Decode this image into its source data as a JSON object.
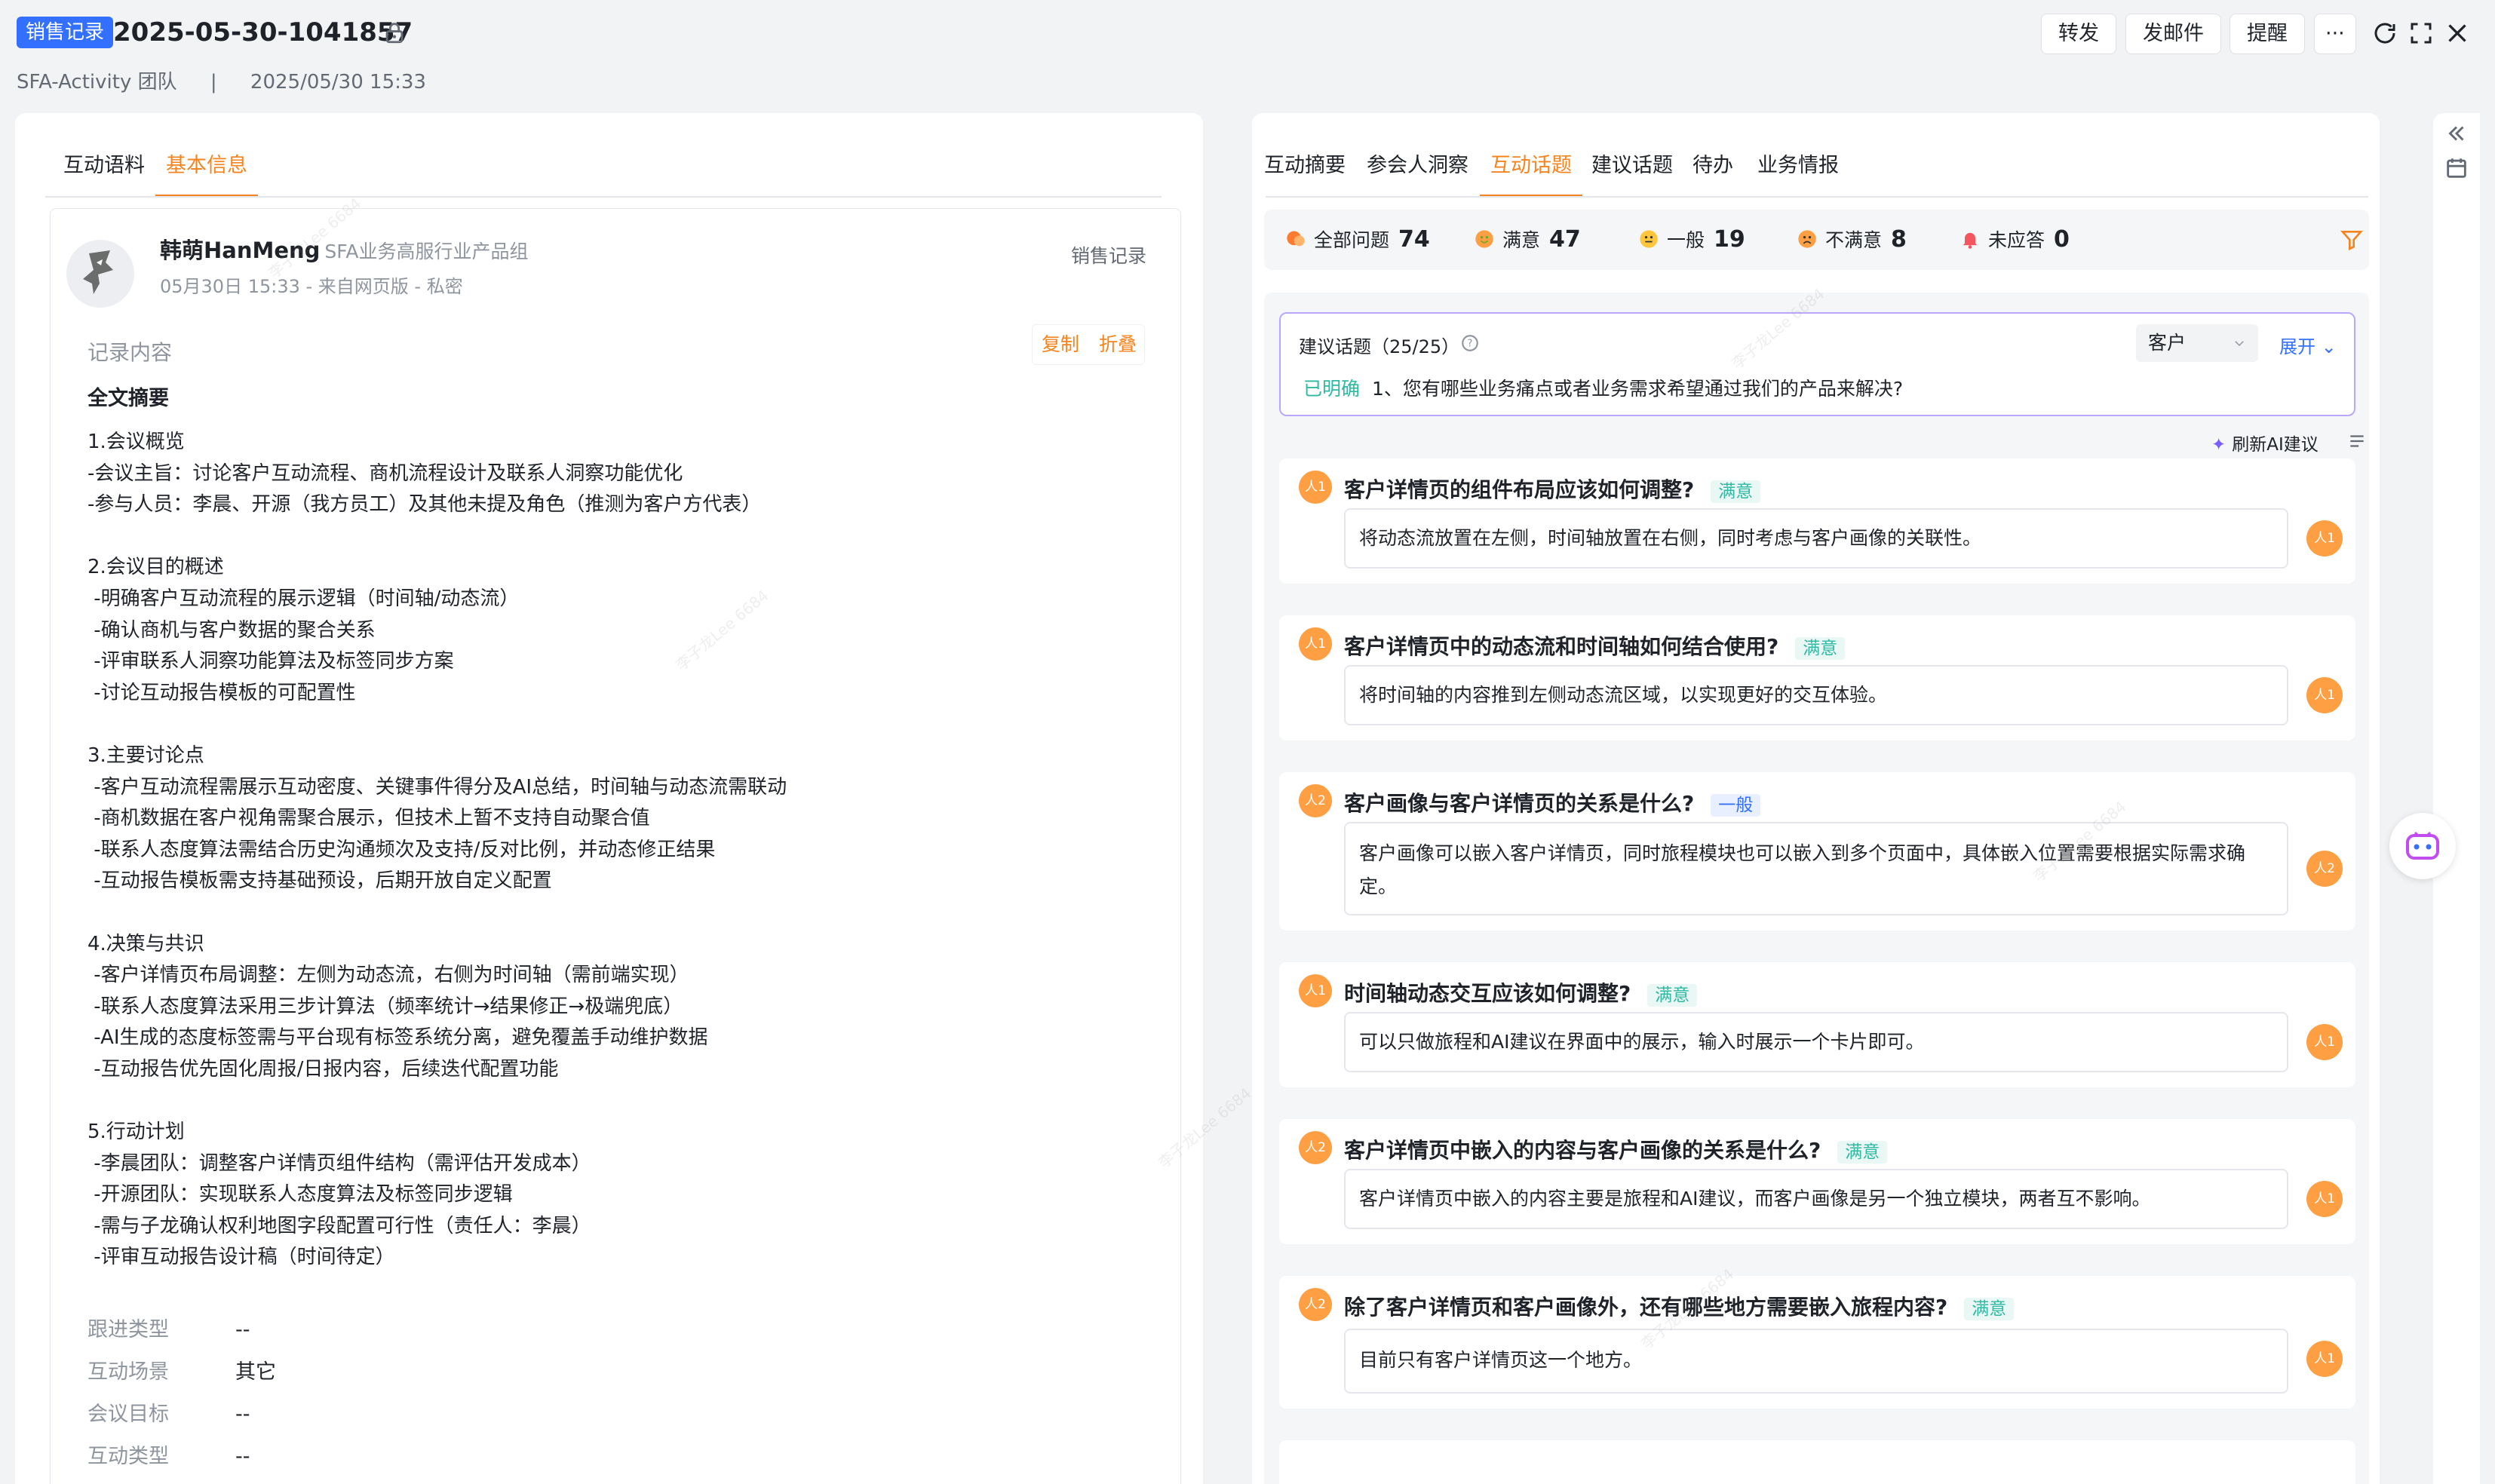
{
  "header": {
    "badge": "销售记录",
    "title": "2025-05-30-1041857",
    "team": "SFA-Activity 团队",
    "separator": "|",
    "datetime": "2025/05/30 15:33",
    "buttons": {
      "forward": "转发",
      "email": "发邮件",
      "remind": "提醒",
      "more": "···"
    }
  },
  "left": {
    "tabs": [
      "互动语料",
      "基本信息"
    ],
    "active_tab": "基本信息",
    "author_name": "韩萌HanMeng",
    "author_dept": "SFA业务高服行业产品组",
    "author_sub": "05月30日 15:33 - 来自网页版 - 私密",
    "record_type": "销售记录",
    "section_label": "记录内容",
    "copy": "复制",
    "fold": "折叠",
    "summary_title": "全文摘要",
    "summary_lines": [
      "1.会议概览",
      "-会议主旨：讨论客户互动流程、商机流程设计及联系人洞察功能优化",
      "-参与人员：李晨、开源（我方员工）及其他未提及角色（推测为客户方代表）",
      "",
      "2.会议目的概述",
      " -明确客户互动流程的展示逻辑（时间轴/动态流）",
      " -确认商机与客户数据的聚合关系",
      " -评审联系人洞察功能算法及标签同步方案",
      " -讨论互动报告模板的可配置性",
      "",
      "3.主要讨论点",
      " -客户互动流程需展示互动密度、关键事件得分及AI总结，时间轴与动态流需联动",
      " -商机数据在客户视角需聚合展示，但技术上暂不支持自动聚合值",
      " -联系人态度算法需结合历史沟通频次及支持/反对比例，并动态修正结果",
      " -互动报告模板需支持基础预设，后期开放自定义配置",
      "",
      "4.决策与共识",
      " -客户详情页布局调整：左侧为动态流，右侧为时间轴（需前端实现）",
      " -联系人态度算法采用三步计算法（频率统计→结果修正→极端兜底）",
      " -AI生成的态度标签需与平台现有标签系统分离，避免覆盖手动维护数据",
      " -互动报告优先固化周报/日报内容，后续迭代配置功能",
      "",
      "5.行动计划",
      " -李晨团队：调整客户详情页组件结构（需评估开发成本）",
      " -开源团队：实现联系人态度算法及标签同步逻辑",
      " -需与子龙确认权利地图字段配置可行性（责任人：李晨）",
      " -评审互动报告设计稿（时间待定）"
    ],
    "fields": [
      {
        "k": "跟进类型",
        "v": "--"
      },
      {
        "k": "互动场景",
        "v": "其它"
      },
      {
        "k": "会议目标",
        "v": "--"
      },
      {
        "k": "互动类型",
        "v": "--"
      }
    ]
  },
  "right": {
    "tabs": [
      "互动摘要",
      "参会人洞察",
      "互动话题",
      "建议话题",
      "待办",
      "业务情报"
    ],
    "active_tab": "互动话题",
    "stats": [
      {
        "label": "全部问题",
        "num": "74"
      },
      {
        "label": "满意",
        "num": "47"
      },
      {
        "label": "一般",
        "num": "19"
      },
      {
        "label": "不满意",
        "num": "8"
      },
      {
        "label": "未应答",
        "num": "0"
      }
    ],
    "suggest_title": "建议话题（25/25）",
    "select_value": "客户",
    "expand": "展开",
    "suggest_tag": "已明确",
    "suggest_question": "1、您有哪些业务痛点或者业务需求希望通过我们的产品来解决?",
    "refresh_ai": "刷新AI建议",
    "qa": [
      {
        "spk": "人1",
        "q": "客户详情页的组件布局应该如何调整?",
        "tag": "满意",
        "a": "将动态流放置在左侧，时间轴放置在右侧，同时考虑与客户画像的关联性。",
        "rspk": "人1"
      },
      {
        "spk": "人1",
        "q": "客户详情页中的动态流和时间轴如何结合使用?",
        "tag": "满意",
        "a": "将时间轴的内容推到左侧动态流区域，以实现更好的交互体验。",
        "rspk": "人1"
      },
      {
        "spk": "人2",
        "q": "客户画像与客户详情页的关系是什么?",
        "tag": "一般",
        "a": "客户画像可以嵌入客户详情页，同时旅程模块也可以嵌入到多个页面中，具体嵌入位置需要根据实际需求确定。",
        "rspk": "人2"
      },
      {
        "spk": "人1",
        "q": "时间轴动态交互应该如何调整?",
        "tag": "满意",
        "a": "可以只做旅程和AI建议在界面中的展示，输入时展示一个卡片即可。",
        "rspk": "人1"
      },
      {
        "spk": "人2",
        "q": "客户详情页中嵌入的内容与客户画像的关系是什么?",
        "tag": "满意",
        "a": "客户详情页中嵌入的内容主要是旅程和AI建议，而客户画像是另一个独立模块，两者互不影响。",
        "rspk": "人1"
      },
      {
        "spk": "人2",
        "q": "除了客户详情页和客户画像外，还有哪些地方需要嵌入旅程内容?",
        "tag": "满意",
        "a": "目前只有客户详情页这一个地方。",
        "rspk": "人1"
      }
    ]
  },
  "colors": {
    "accent": "#f5841f",
    "brand": "#3370ff",
    "satisfied": "#2fb9a3",
    "speaker": "#ff9f43"
  }
}
